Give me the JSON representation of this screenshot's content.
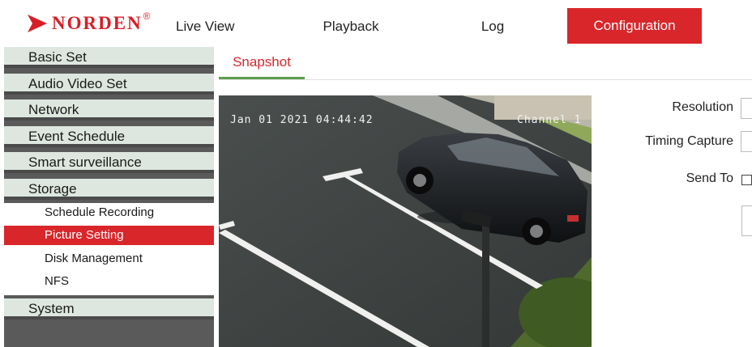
{
  "brand": {
    "name": "NORDEN",
    "registered": "®",
    "color": "#d81e25"
  },
  "nav": {
    "items": [
      {
        "label": "Live View"
      },
      {
        "label": "Playback"
      },
      {
        "label": "Log"
      },
      {
        "label": "Configuration",
        "active": true
      }
    ],
    "active_color": "#d9262b"
  },
  "sidebar": {
    "sections": [
      {
        "label": "Basic Set"
      },
      {
        "label": "Audio Video Set"
      },
      {
        "label": "Network"
      },
      {
        "label": "Event Schedule"
      },
      {
        "label": "Smart surveillance"
      },
      {
        "label": "Storage",
        "expanded": true
      },
      {
        "label": "System"
      }
    ],
    "storage_items": [
      {
        "label": "Schedule Recording"
      },
      {
        "label": "Picture Setting",
        "active": true
      },
      {
        "label": "Disk Management"
      },
      {
        "label": "NFS"
      }
    ]
  },
  "tabs": [
    {
      "label": "Snapshot",
      "active": true
    }
  ],
  "preview": {
    "timestamp": "Jan 01 2021 04:44:42",
    "channel": "Channel 1"
  },
  "form": {
    "resolution_label": "Resolution",
    "timing_capture_label": "Timing Capture",
    "send_to_label": "Send To",
    "send_to_checked": false
  }
}
